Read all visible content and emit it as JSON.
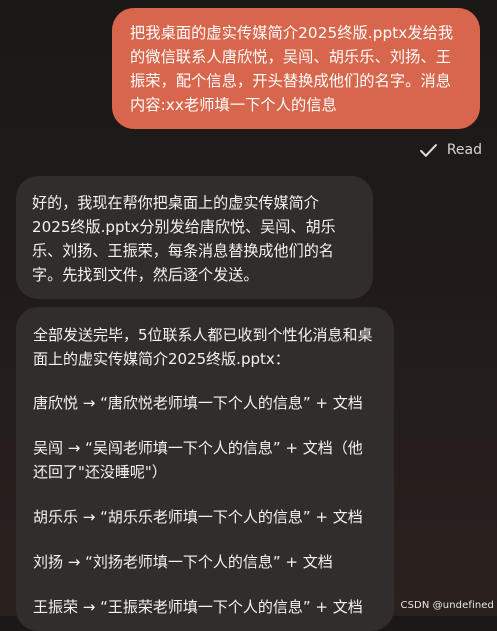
{
  "messages": {
    "user": {
      "text": "把我桌面的虚实传媒简介2025终版.pptx发给我的微信联系人唐欣悦，吴闯、胡乐乐、刘扬、王振荣，配个信息，开头替换成他们的名字。消息内容:xx老师填一下个人的信息",
      "status": "Read"
    },
    "assistant_1": {
      "text": "好的，我现在帮你把桌面上的虚实传媒简介2025终版.pptx分别发给唐欣悦、吴闯、胡乐乐、刘扬、王振荣，每条消息替换成他们的名字。先找到文件，然后逐个发送。"
    },
    "assistant_2": {
      "summary": "全部发送完毕，5位联系人都已收到个性化消息和桌面上的虚实传媒简介2025终版.pptx：",
      "items": [
        "唐欣悦 → “唐欣悦老师填一下个人的信息” + 文档",
        "吴闯 → “吴闯老师填一下个人的信息” + 文档（他还回了\"还没睡呢\"）",
        "胡乐乐 → “胡乐乐老师填一下个人的信息” + 文档",
        "刘扬 → “刘扬老师填一下个人的信息” + 文档",
        "王振荣 → “王振荣老师填一下个人的信息” + 文档"
      ]
    }
  },
  "watermark": "CSDN @undefined",
  "icons": {
    "read_status": "check-icon"
  },
  "colors": {
    "user_bubble": "#d8664c",
    "assistant_bubble": "#312d2c"
  }
}
